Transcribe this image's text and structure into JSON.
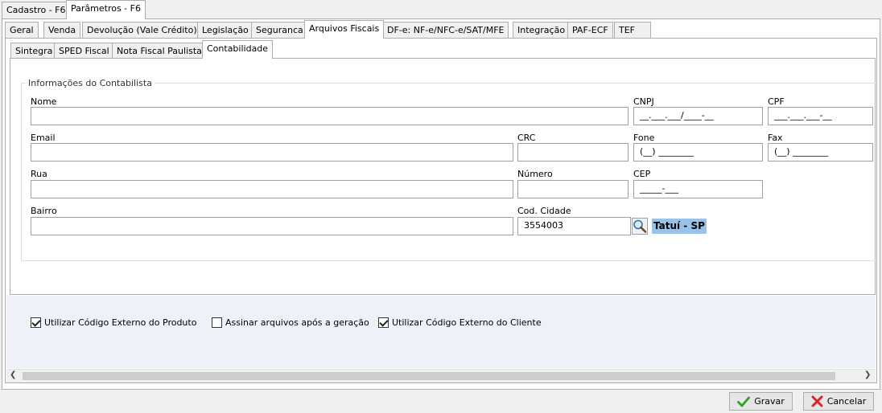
{
  "window_tabs": [
    "Cadastro - F6",
    "Parâmetros - F6"
  ],
  "main_tabs": [
    "Geral",
    "Venda",
    "Devolução (Vale Crédito)",
    "Legislação",
    "Seguranca",
    "Arquivos Fiscais",
    "DF-e: NF-e/NFC-e/SAT/MFE",
    "Integração",
    "PAF-ECF",
    "TEF"
  ],
  "sub_tabs": [
    "Sintegra",
    "SPED Fiscal",
    "Nota Fiscal Paulista",
    "Contabilidade"
  ],
  "group_title": "Informações do Contabilista",
  "fields": {
    "nome": {
      "label": "Nome",
      "value": ""
    },
    "cnpj": {
      "label": "CNPJ",
      "value": "__.___.___/____-__"
    },
    "cpf": {
      "label": "CPF",
      "value": "___.___.___-__"
    },
    "email": {
      "label": "Email",
      "value": ""
    },
    "crc": {
      "label": "CRC",
      "value": ""
    },
    "fone": {
      "label": "Fone",
      "value": "(__) ________"
    },
    "fax": {
      "label": "Fax",
      "value": "(__) ________"
    },
    "rua": {
      "label": "Rua",
      "value": ""
    },
    "numero": {
      "label": "Número",
      "value": ""
    },
    "cep": {
      "label": "CEP",
      "value": "_____-___"
    },
    "bairro": {
      "label": "Bairro",
      "value": ""
    },
    "cod_cidade": {
      "label": "Cod. Cidade",
      "value": "3554003"
    }
  },
  "cidade_nome": "Tatuí  -  SP",
  "checkboxes": {
    "cod_ext_produto": {
      "label": "Utilizar Código Externo do Produto",
      "checked": true
    },
    "assinar_arquivos": {
      "label": "Assinar arquivos após a geração",
      "checked": false
    },
    "cod_ext_cliente": {
      "label": "Utilizar Código Externo do Cliente",
      "checked": true
    }
  },
  "buttons": {
    "gravar": "Gravar",
    "cancelar": "Cancelar"
  },
  "icons": {
    "search": "magnifier-icon",
    "save": "green-check-icon",
    "cancel": "red-x-icon"
  },
  "colors": {
    "highlight": "#99c2e8",
    "check_green": "#2e9e2e",
    "cancel_red": "#d92626"
  }
}
